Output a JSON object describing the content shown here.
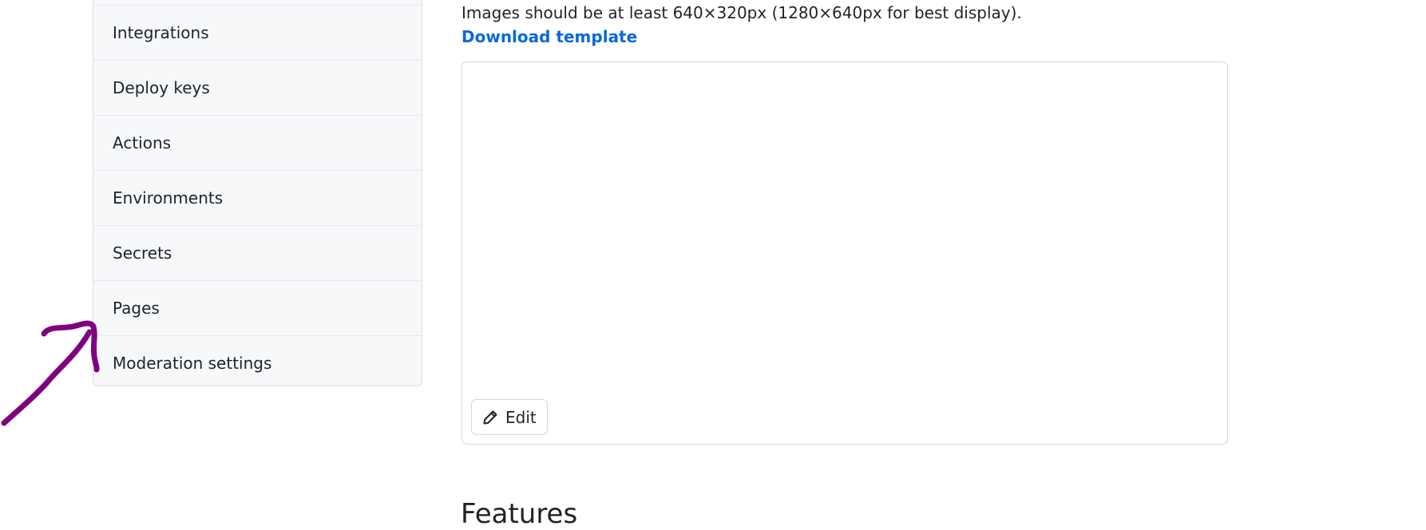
{
  "sidebar": {
    "items": [
      {
        "label": "Integrations"
      },
      {
        "label": "Deploy keys"
      },
      {
        "label": "Actions"
      },
      {
        "label": "Environments"
      },
      {
        "label": "Secrets"
      },
      {
        "label": "Pages"
      },
      {
        "label": "Moderation settings"
      }
    ]
  },
  "social_preview": {
    "hint": "Images should be at least 640×320px (1280×640px for best display).",
    "download_label": "Download template",
    "edit_label": "Edit",
    "edit_icon": "pencil-icon"
  },
  "features": {
    "heading": "Features"
  },
  "annotation": {
    "icon": "hand-drawn-arrow-icon",
    "color": "#800080"
  },
  "colors": {
    "link": "#0969da",
    "sidebar_bg": "#f6f8fa",
    "border": "#d0d7de"
  }
}
